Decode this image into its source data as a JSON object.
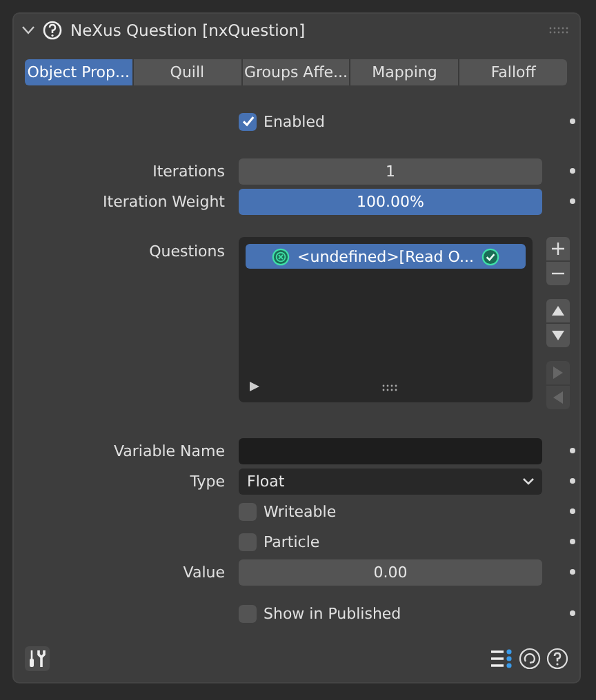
{
  "panel": {
    "title": "NeXus Question [nxQuestion]",
    "expanded": true
  },
  "tabs": [
    {
      "label": "Object Prop...",
      "selected": true
    },
    {
      "label": "Quill",
      "selected": false
    },
    {
      "label": "Groups Affe...",
      "selected": false
    },
    {
      "label": "Mapping",
      "selected": false
    },
    {
      "label": "Falloff",
      "selected": false
    }
  ],
  "top_groups": [
    [
      {
        "kind": "checkbox",
        "label": "Enabled",
        "checked": true
      }
    ],
    [
      {
        "kind": "number",
        "label": "Iterations",
        "value": "1"
      },
      {
        "kind": "slider",
        "label": "Iteration Weight",
        "value": "100.00%",
        "level": 1
      }
    ]
  ],
  "questions": {
    "label": "Questions",
    "items": [
      {
        "text": "<undefined>[Read O...",
        "selected": true
      }
    ]
  },
  "bottom_groups": [
    [
      {
        "kind": "text",
        "label": "Variable Name"
      },
      {
        "kind": "dropdown",
        "label": "Type",
        "value": "Float"
      },
      {
        "kind": "checkbox",
        "label": "Writeable",
        "checked": false
      },
      {
        "kind": "checkbox",
        "label": "Particle",
        "checked": false
      },
      {
        "kind": "number",
        "label": "Value",
        "value": "0.00"
      }
    ],
    [
      {
        "kind": "checkbox",
        "label": "Show in Published",
        "checked": false
      }
    ]
  ]
}
